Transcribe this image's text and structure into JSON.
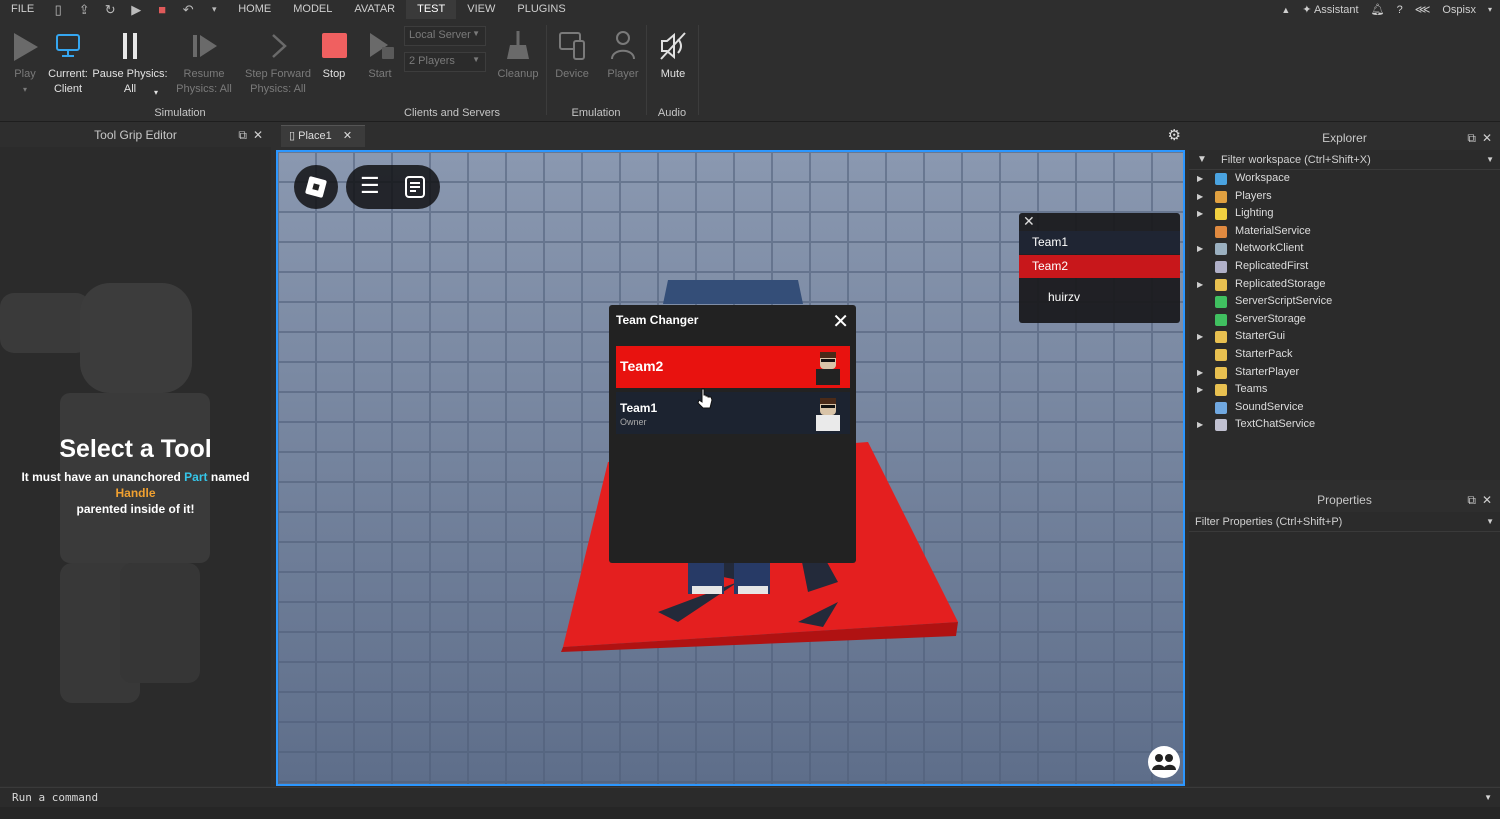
{
  "menubar": {
    "file": "FILE",
    "tabs": [
      {
        "label": "HOME"
      },
      {
        "label": "MODEL"
      },
      {
        "label": "AVATAR"
      },
      {
        "label": "TEST"
      },
      {
        "label": "VIEW"
      },
      {
        "label": "PLUGINS"
      }
    ],
    "assistant": "Assistant",
    "user": "Ospisx"
  },
  "ribbon": {
    "play": "Play",
    "current_client_1": "Current:",
    "current_client_2": "Client",
    "pause_physics_1": "Pause Physics:",
    "pause_physics_2": "All",
    "resume_1": "Resume",
    "resume_2": "Physics: All",
    "step_forward_1": "Step Forward",
    "step_forward_2": "Physics: All",
    "stop": "Stop",
    "simulation_label": "Simulation",
    "start": "Start",
    "server_dropdown": "Local Server",
    "players_dropdown": "2 Players",
    "cleanup": "Cleanup",
    "clients_servers_label": "Clients and Servers",
    "device": "Device",
    "player": "Player",
    "emulation_label": "Emulation",
    "mute": "Mute",
    "audio_label": "Audio"
  },
  "tool_grip": {
    "panel_title": "Tool Grip Editor",
    "heading": "Select a Tool",
    "desc_1": "It must have an unanchored",
    "desc_part": "Part",
    "desc_named": "named",
    "desc_handle": "Handle",
    "desc_2": "parented inside of it!"
  },
  "document": {
    "tab_label": "Place1"
  },
  "team_changer": {
    "title": "Team Changer",
    "teams": [
      {
        "name": "Team2",
        "sub": "",
        "color": "#e8120f"
      },
      {
        "name": "Team1",
        "sub": "Owner",
        "color": "#1c2330"
      }
    ]
  },
  "leaderboard": {
    "rows": [
      {
        "label": "Team1"
      },
      {
        "label": "Team2"
      },
      {
        "label": "huirzv"
      }
    ]
  },
  "explorer": {
    "title": "Explorer",
    "filter_placeholder": "Filter workspace (Ctrl+Shift+X)",
    "items": [
      {
        "label": "Workspace",
        "expandable": true,
        "icon": "workspace-icon",
        "color": "#4aa3e0"
      },
      {
        "label": "Players",
        "expandable": true,
        "icon": "players-icon",
        "color": "#e0a040"
      },
      {
        "label": "Lighting",
        "expandable": true,
        "icon": "lighting-icon",
        "color": "#f0d040"
      },
      {
        "label": "MaterialService",
        "expandable": false,
        "icon": "material-service-icon",
        "color": "#e08a40"
      },
      {
        "label": "NetworkClient",
        "expandable": true,
        "icon": "network-client-icon",
        "color": "#9bb0c0"
      },
      {
        "label": "ReplicatedFirst",
        "expandable": false,
        "icon": "replicated-first-icon",
        "color": "#b0b0c8"
      },
      {
        "label": "ReplicatedStorage",
        "expandable": true,
        "icon": "replicated-storage-icon",
        "color": "#e8c050"
      },
      {
        "label": "ServerScriptService",
        "expandable": false,
        "icon": "server-script-service-icon",
        "color": "#40c060"
      },
      {
        "label": "ServerStorage",
        "expandable": false,
        "icon": "server-storage-icon",
        "color": "#40c060"
      },
      {
        "label": "StarterGui",
        "expandable": true,
        "icon": "starter-gui-icon",
        "color": "#e8c050"
      },
      {
        "label": "StarterPack",
        "expandable": false,
        "icon": "starter-pack-icon",
        "color": "#e8c050"
      },
      {
        "label": "StarterPlayer",
        "expandable": true,
        "icon": "starter-player-icon",
        "color": "#e8c050"
      },
      {
        "label": "Teams",
        "expandable": true,
        "icon": "teams-icon",
        "color": "#e8c050"
      },
      {
        "label": "SoundService",
        "expandable": false,
        "icon": "sound-service-icon",
        "color": "#70a8e0"
      },
      {
        "label": "TextChatService",
        "expandable": true,
        "icon": "text-chat-service-icon",
        "color": "#c0c0d0"
      }
    ]
  },
  "properties": {
    "title": "Properties",
    "filter_placeholder": "Filter Properties (Ctrl+Shift+P)"
  },
  "command_bar": {
    "placeholder": "Run a command"
  },
  "colors": {
    "accent_blue": "#2c97ff",
    "stop_red": "#e05a5a",
    "team_red": "#e8120f"
  }
}
